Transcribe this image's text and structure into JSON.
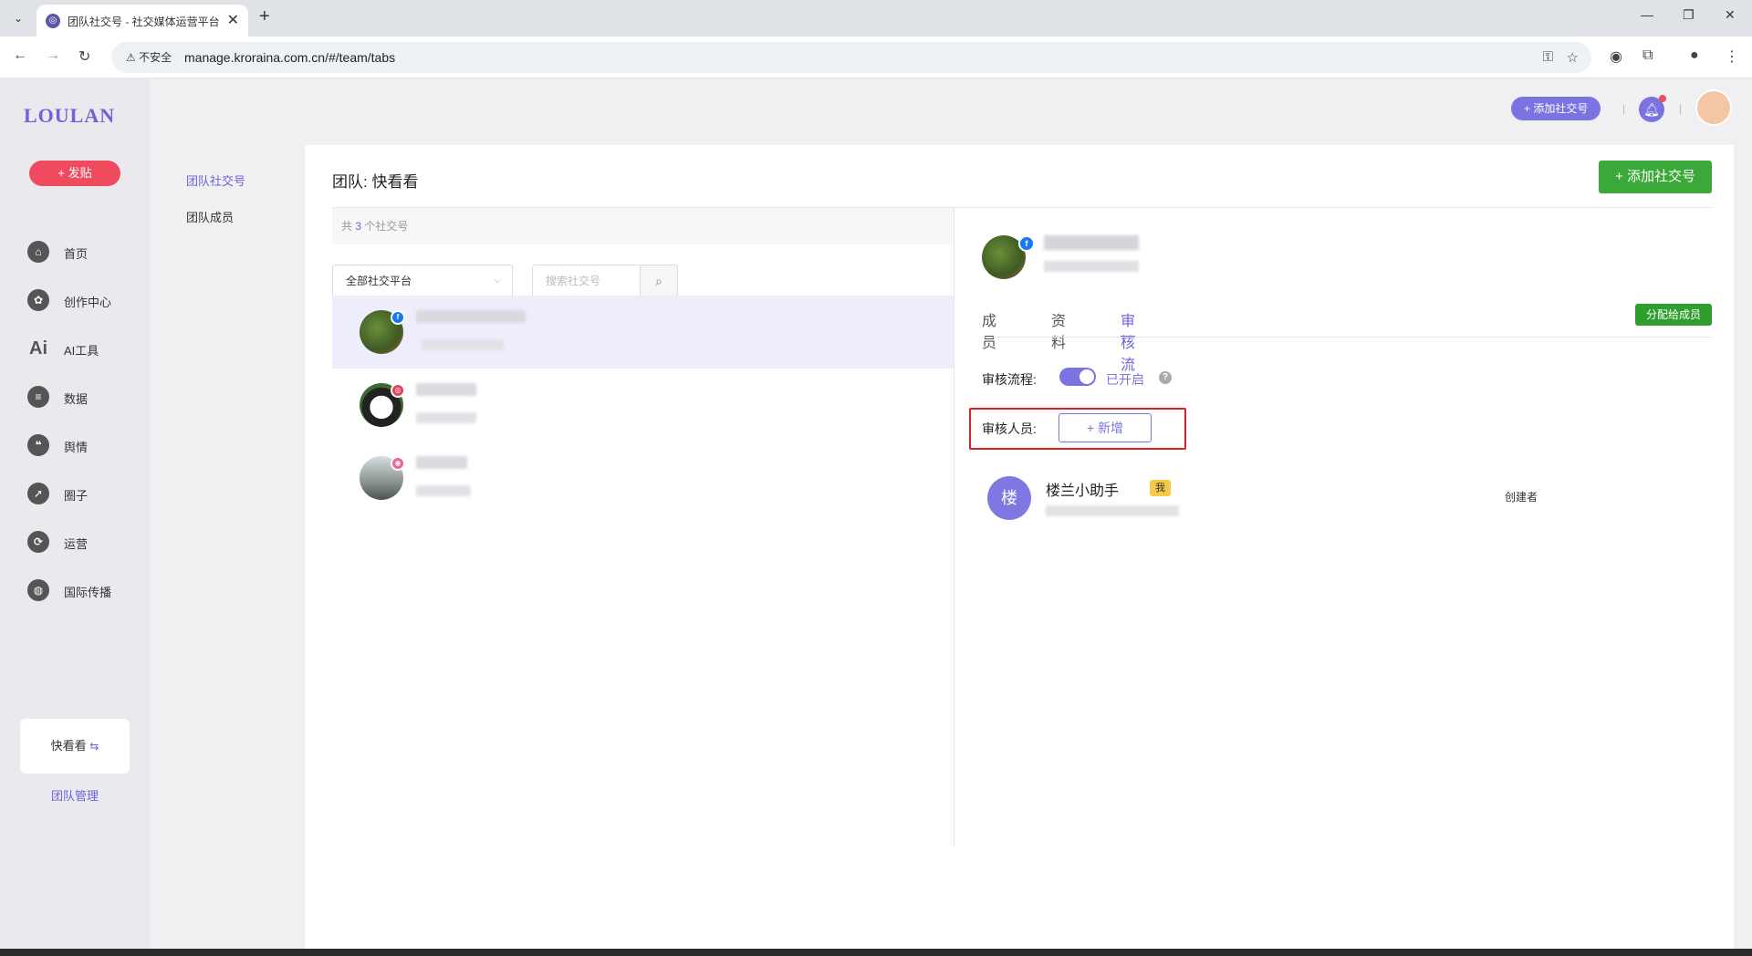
{
  "browser": {
    "tab_title": "团队社交号 - 社交媒体运营平台",
    "new_tab": "+",
    "security": "不安全",
    "url": "manage.kroraina.com.cn/#/team/tabs"
  },
  "app": {
    "logo": "LOULAN",
    "post_button": "+ 发贴",
    "nav": [
      {
        "label": "首页",
        "icon": "home-icon"
      },
      {
        "label": "创作中心",
        "icon": "palette-icon"
      },
      {
        "label": "AI工具",
        "icon": "ai-icon"
      },
      {
        "label": "数据",
        "icon": "database-icon"
      },
      {
        "label": "舆情",
        "icon": "quote-icon"
      },
      {
        "label": "圈子",
        "icon": "compass-icon"
      },
      {
        "label": "运营",
        "icon": "operation-icon"
      },
      {
        "label": "国际传播",
        "icon": "globe-icon"
      }
    ],
    "team_card": "快看看",
    "team_card_swap": "⇆",
    "team_manage": "团队管理"
  },
  "sub_nav": {
    "items": [
      "团队社交号",
      "团队成员"
    ]
  },
  "header": {
    "add_pill": "+ 添加社交号"
  },
  "main": {
    "title": "团队: 快看看",
    "add_social_button": "+ 添加社交号",
    "count_prefix": "共",
    "count": "3",
    "count_suffix": "个社交号",
    "platform_select": "全部社交平台",
    "search_placeholder": "搜索社交号",
    "accounts": [
      {
        "platform": "facebook",
        "badge": "f",
        "badge_color": "#1877f2"
      },
      {
        "platform": "instagram",
        "badge": "◎",
        "badge_color": "#e4405f"
      },
      {
        "platform": "other",
        "badge": "◉",
        "badge_color": "#f06595"
      }
    ]
  },
  "detail": {
    "assign_button": "分配给成员",
    "tabs": [
      "成员",
      "资料",
      "审核流"
    ],
    "active_tab": "审核流",
    "flow_label": "审核流程:",
    "flow_status": "已开启",
    "reviewer_label": "审核人员:",
    "add_reviewer": "+ 新增",
    "member": {
      "initial": "楼",
      "name": "楼兰小助手",
      "tag": "我",
      "role": "创建者"
    }
  },
  "colors": {
    "accent": "#6c63d9",
    "green": "#3aa93a",
    "red": "#ef4b5f"
  }
}
